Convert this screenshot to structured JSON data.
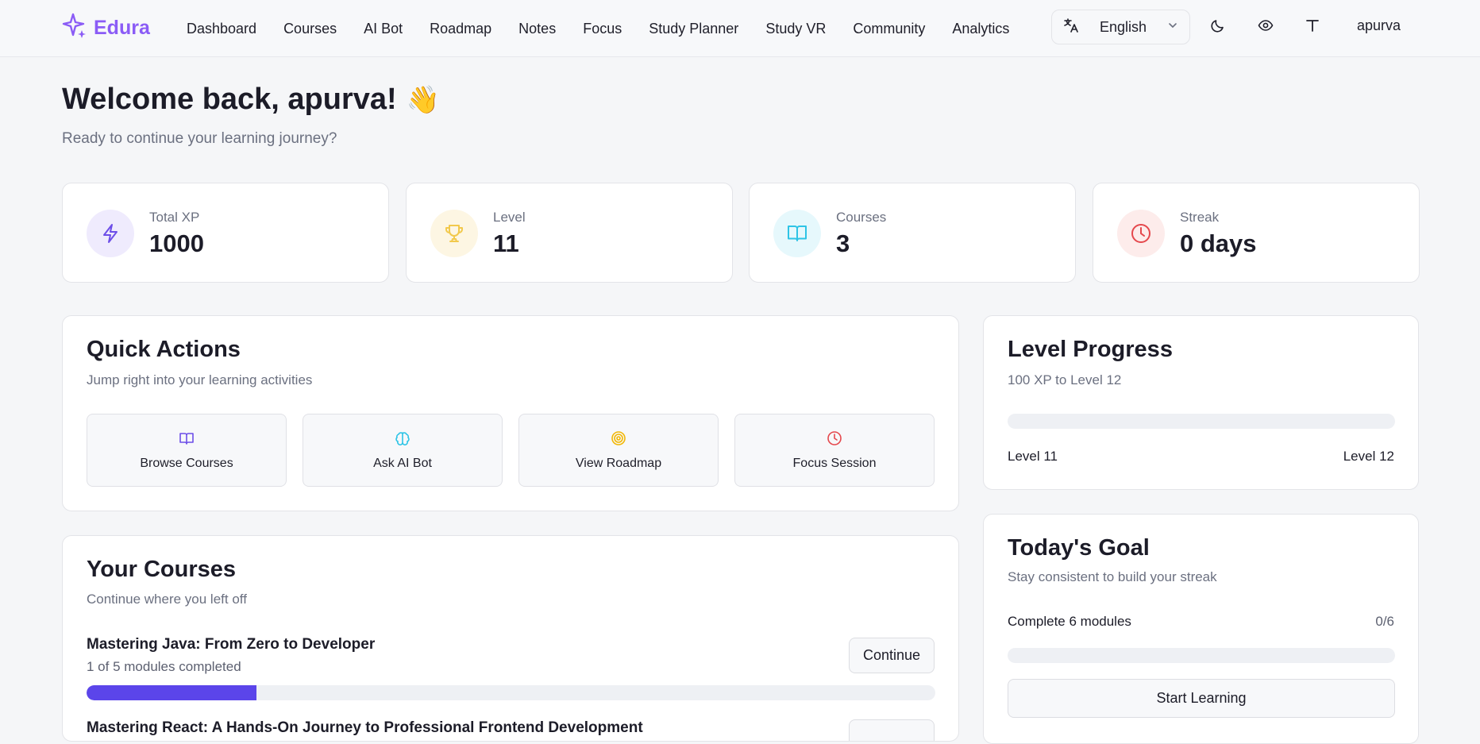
{
  "nav": {
    "brand": "Edura",
    "links": [
      "Dashboard",
      "Courses",
      "AI Bot",
      "Roadmap",
      "Notes",
      "Focus",
      "Study Planner",
      "Study VR",
      "Community",
      "Analytics"
    ],
    "language": "English",
    "user": "apurva",
    "icons": [
      "translate-icon",
      "chevron-down-icon",
      "moon-icon",
      "eye-icon",
      "text-size-icon"
    ]
  },
  "header": {
    "welcome": "Welcome back, apurva!",
    "emoji": "👋",
    "subtitle": "Ready to continue your learning journey?"
  },
  "stats": [
    {
      "label": "Total XP",
      "value": "1000",
      "icon": "lightning-icon",
      "color": "#6d4ee8",
      "bg": "#efebfd"
    },
    {
      "label": "Level",
      "value": "11",
      "icon": "trophy-icon",
      "color": "#f2c94c",
      "bg": "#fdf6e3"
    },
    {
      "label": "Courses",
      "value": "3",
      "icon": "book-open-icon",
      "color": "#2ec4e6",
      "bg": "#e6f8fc"
    },
    {
      "label": "Streak",
      "value": "0 days",
      "icon": "clock-icon",
      "color": "#e5484d",
      "bg": "#fdeceb"
    }
  ],
  "quick_actions": {
    "title": "Quick Actions",
    "subtitle": "Jump right into your learning activities",
    "items": [
      {
        "label": "Browse Courses",
        "icon": "book-open-icon",
        "color": "#6d4ee8"
      },
      {
        "label": "Ask AI Bot",
        "icon": "brain-icon",
        "color": "#2ec4e6"
      },
      {
        "label": "View Roadmap",
        "icon": "target-icon",
        "color": "#f2b705"
      },
      {
        "label": "Focus Session",
        "icon": "clock-icon",
        "color": "#e5484d"
      }
    ]
  },
  "your_courses": {
    "title": "Your Courses",
    "subtitle": "Continue where you left off",
    "courses": [
      {
        "title": "Mastering Java: From Zero to Developer",
        "meta": "1 of 5 modules completed",
        "progress": 0.2,
        "action": "Continue"
      },
      {
        "title": "Mastering React: A Hands-On Journey to Professional Frontend Development"
      }
    ]
  },
  "level_progress": {
    "title": "Level Progress",
    "subtitle": "100 XP to Level 12",
    "progress": 0,
    "from_label": "Level 11",
    "to_label": "Level 12"
  },
  "todays_goal": {
    "title": "Today's Goal",
    "subtitle": "Stay consistent to build your streak",
    "goal_label": "Complete 6 modules",
    "goal_count": "0/6",
    "progress": 0,
    "button": "Start Learning"
  },
  "colors": {
    "accent": "#5b45ea",
    "brand": "#8b5cf6"
  }
}
